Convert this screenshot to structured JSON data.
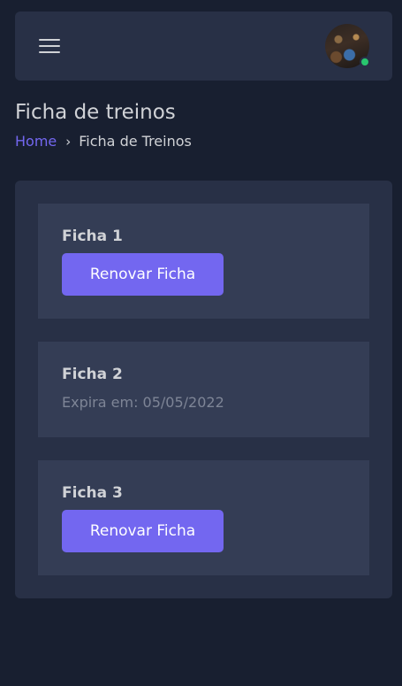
{
  "header": {
    "menu_icon": "hamburger-menu-icon",
    "avatar_status_color": "#28c76f"
  },
  "page": {
    "title": "Ficha de treinos",
    "breadcrumb": {
      "home": "Home",
      "separator": "›",
      "current": "Ficha de Treinos"
    }
  },
  "fichas": [
    {
      "title": "Ficha 1",
      "button_label": "Renovar Ficha"
    },
    {
      "title": "Ficha 2",
      "expiry": "Expira em: 05/05/2022"
    },
    {
      "title": "Ficha 3",
      "button_label": "Renovar Ficha"
    }
  ],
  "colors": {
    "background": "#181f30",
    "card": "#283046",
    "ficha": "#343d55",
    "accent": "#7367f0",
    "text": "#d0d2d6",
    "muted_text": "#7e8596"
  }
}
